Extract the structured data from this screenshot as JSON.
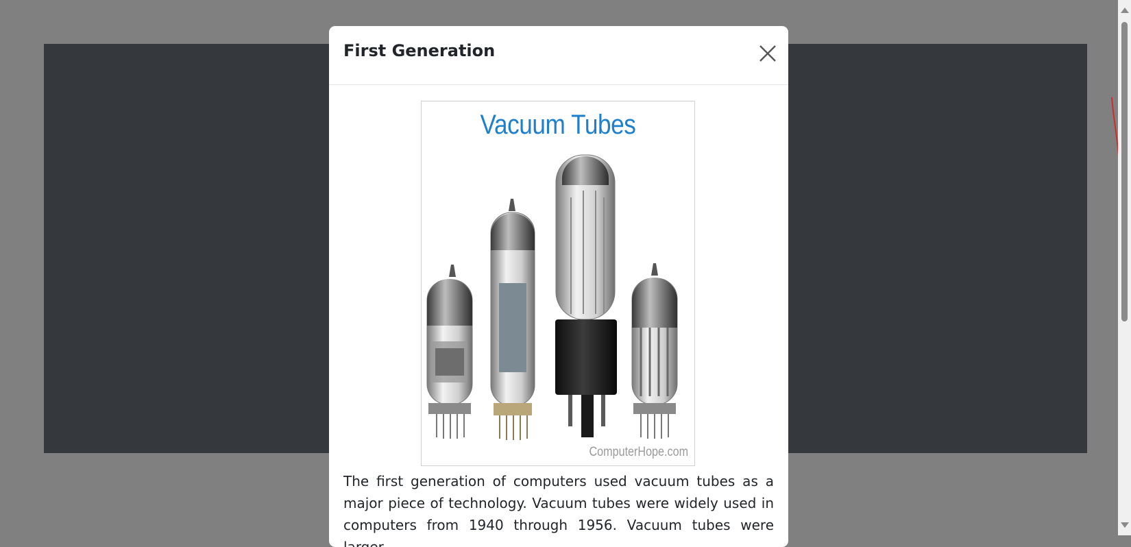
{
  "modal": {
    "title": "First Generation",
    "close_icon": "close-icon",
    "image": {
      "title": "Vacuum Tubes",
      "watermark": "ComputerHope.com",
      "depicts": "vacuum-tubes-photo"
    },
    "body_text": "The first generation of computers used vacuum tubes as a major piece of technology. Vacuum tubes were widely used in computers from 1940 through 1956. Vacuum tubes were larger"
  },
  "colors": {
    "backdrop": "#808080",
    "dark_panel": "#35383c",
    "modal_bg": "#ffffff",
    "image_title": "#1e80cc",
    "scrollbar_track": "#f0f0f0",
    "scrollbar_thumb": "#8a8a8a"
  }
}
